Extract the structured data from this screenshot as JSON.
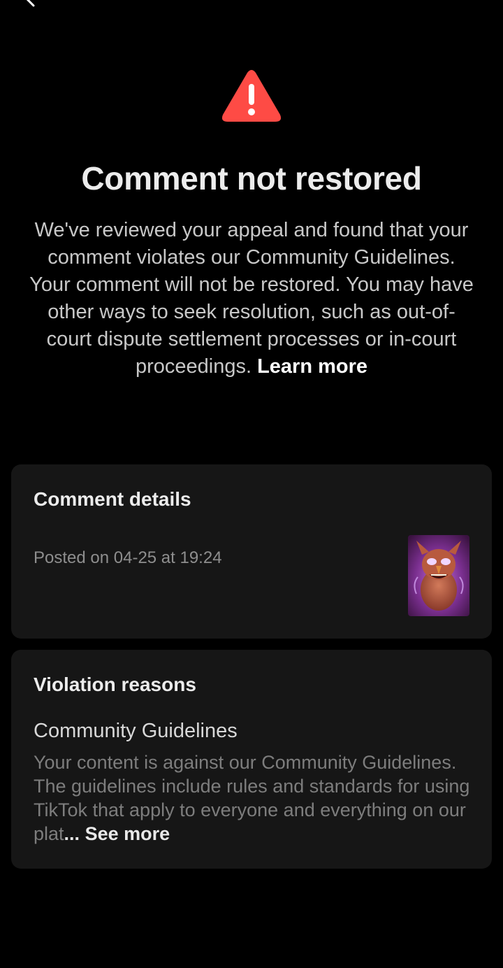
{
  "header": {
    "back_icon": "chevron-left-icon"
  },
  "alert": {
    "icon": "warning-triangle-icon",
    "icon_color": "#FE4B45",
    "title": "Comment not restored",
    "description": "We've reviewed your appeal and found that your comment violates our Community Guidelines. Your comment will not be restored. You may have other ways to seek resolution, such as out-of-court dispute settlement processes or in-court proceedings.",
    "learn_more": "Learn more"
  },
  "comment_details": {
    "title": "Comment details",
    "posted": "Posted on 04-25 at 19:24",
    "thumbnail": "video-thumbnail"
  },
  "violation": {
    "title": "Violation reasons",
    "reason_title": "Community Guidelines",
    "reason_body": "Your content is against our Community Guidelines. The guidelines include rules and standards for using TikTok that apply to everyone and everything on our plat",
    "ellipsis": "...",
    "see_more": "See more"
  },
  "colors": {
    "background": "#000000",
    "card": "#161616",
    "accent_red": "#FE4B45"
  }
}
